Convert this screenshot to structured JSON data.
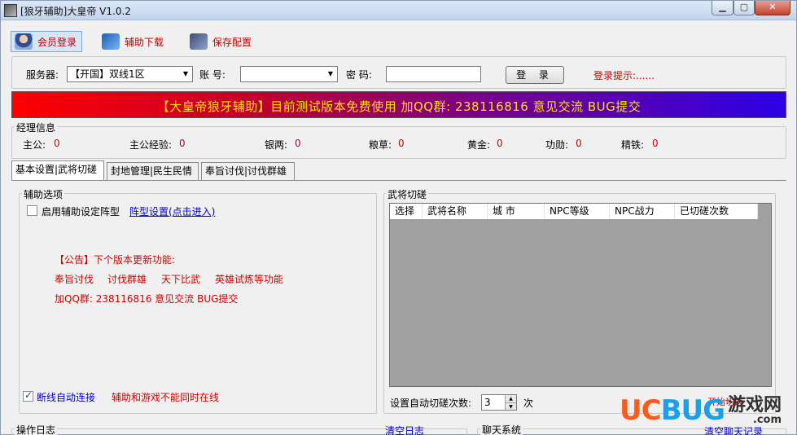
{
  "window": {
    "title": "[狼牙辅助]大皇帝 V1.0.2"
  },
  "toolbar": {
    "member_login": "会员登录",
    "download": "辅助下载",
    "save_config": "保存配置"
  },
  "login": {
    "server_label": "服务器:",
    "server_value": "【开国】双线1区",
    "account_label": "账  号:",
    "account_value": "",
    "password_label": "密  码:",
    "password_value": "",
    "login_button": "登 录",
    "hint": "登录提示:......"
  },
  "banner": {
    "text": "【大皇帝狼牙辅助】目前测试版本免费使用    加QQ群: 238116816 意见交流 BUG提交"
  },
  "manager_info": {
    "title": "经理信息",
    "fields": [
      {
        "label": "主公:",
        "value": "0"
      },
      {
        "label": "主公经验:",
        "value": "0"
      },
      {
        "label": "银两:",
        "value": "0"
      },
      {
        "label": "粮草:",
        "value": "0"
      },
      {
        "label": "黄金:",
        "value": "0"
      },
      {
        "label": "功勋:",
        "value": "0"
      },
      {
        "label": "精铁:",
        "value": "0"
      }
    ]
  },
  "tabs": [
    "基本设置|武将切磋",
    "封地管理|民生民情",
    "奉旨讨伐|讨伐群雄"
  ],
  "assist": {
    "title": "辅助选项",
    "enable_formation_label": "启用辅助设定阵型",
    "enable_formation_checked": false,
    "formation_link": "阵型设置(点击进入)",
    "notice_title": "【公告】下个版本更新功能:",
    "features": [
      "奉旨讨伐",
      "讨伐群雄",
      "天下比武",
      "英雄试炼等功能"
    ],
    "qq_line": "加QQ群: 238116816 意见交流 BUG提交",
    "auto_reconnect_label": "断线自动连接",
    "auto_reconnect_checked": true,
    "warning": "辅助和游戏不能同时在线"
  },
  "spar": {
    "title": "武将切磋",
    "columns": [
      "选择",
      "武将名称",
      "城  市",
      "NPC等级",
      "NPC战力",
      "已切磋次数"
    ],
    "rows": [],
    "auto_label": "设置自动切磋次数:",
    "auto_value": "3",
    "unit": "次",
    "partial_button": "开始切磋"
  },
  "log": {
    "title": "操作日志",
    "clear": "清空日志"
  },
  "chat": {
    "title": "聊天系统",
    "clear": "清空聊天记录"
  },
  "watermark": {
    "uc": "UC",
    "bug": "BUG",
    "cn": "游戏网",
    "domain": ".com"
  }
}
